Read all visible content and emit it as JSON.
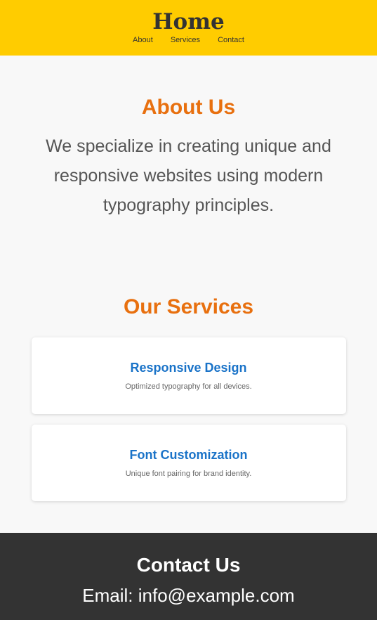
{
  "header": {
    "title": "Home",
    "nav": [
      {
        "label": "About"
      },
      {
        "label": "Services"
      },
      {
        "label": "Contact"
      }
    ]
  },
  "about": {
    "heading": "About Us",
    "text": "We specialize in creating unique and responsive websites using modern typography principles."
  },
  "services": {
    "heading": "Our Services",
    "items": [
      {
        "title": "Responsive Design",
        "description": "Optimized typography for all devices."
      },
      {
        "title": "Font Customization",
        "description": "Unique font pairing for brand identity."
      }
    ]
  },
  "contact": {
    "heading": "Contact Us",
    "email_text": "Email: info@example.com"
  },
  "colors": {
    "header_bg": "#ffcc00",
    "accent_orange": "#e8700f",
    "service_title_blue": "#1a73c8",
    "footer_bg": "#333333"
  }
}
